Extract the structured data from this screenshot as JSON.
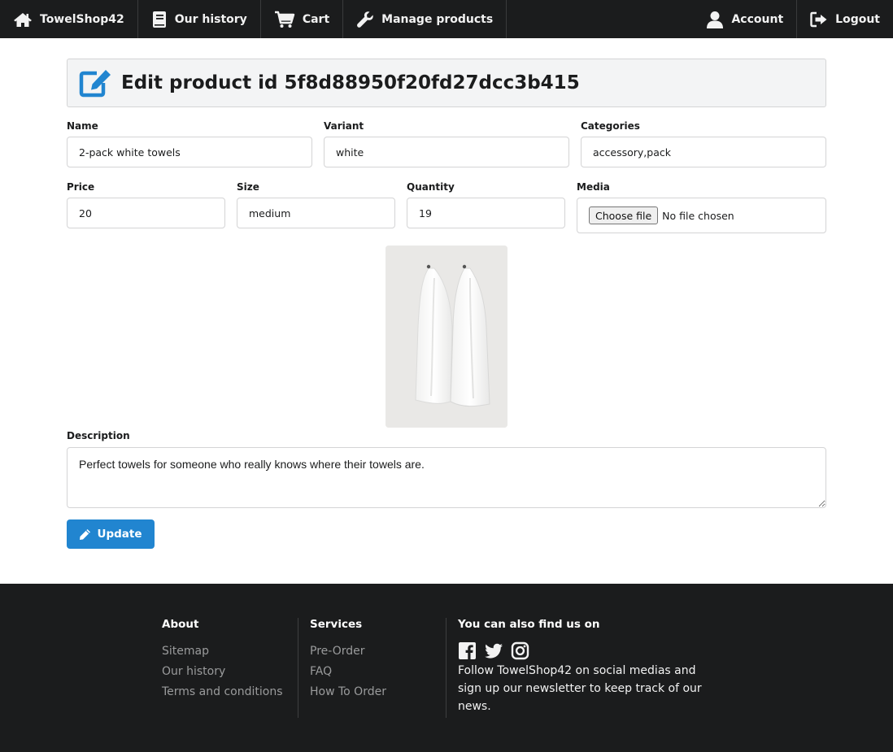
{
  "nav": {
    "brand": "TowelShop42",
    "history": "Our history",
    "cart": "Cart",
    "manage": "Manage products",
    "account": "Account",
    "logout": "Logout"
  },
  "header": {
    "title": "Edit product id 5f8d88950f20fd27dcc3b415"
  },
  "form": {
    "name": {
      "label": "Name",
      "value": "2-pack white towels"
    },
    "variant": {
      "label": "Variant",
      "value": "white"
    },
    "categories": {
      "label": "Categories",
      "value": "accessory,pack"
    },
    "price": {
      "label": "Price",
      "value": "20"
    },
    "size": {
      "label": "Size",
      "value": "medium"
    },
    "quantity": {
      "label": "Quantity",
      "value": "19"
    },
    "media": {
      "label": "Media",
      "button": "Choose file",
      "status": "No file chosen"
    },
    "description": {
      "label": "Description",
      "value": "Perfect towels for someone who really knows where their towels are."
    },
    "update_label": "Update"
  },
  "footer": {
    "about": {
      "title": "About",
      "links": [
        "Sitemap",
        "Our history",
        "Terms and conditions"
      ]
    },
    "services": {
      "title": "Services",
      "links": [
        "Pre-Order",
        "FAQ",
        "How To Order"
      ]
    },
    "social": {
      "title": "You can also find us on",
      "icons": [
        "facebook-icon",
        "twitter-icon",
        "instagram-icon"
      ],
      "text": "Follow TowelShop42 on social medias and sign up our newsletter to keep track of our news."
    }
  },
  "colors": {
    "nav_bg": "#1b1c1d",
    "primary": "#2185d0",
    "header_bg": "#f3f4f5",
    "footer_link": "#9a9b9c"
  }
}
